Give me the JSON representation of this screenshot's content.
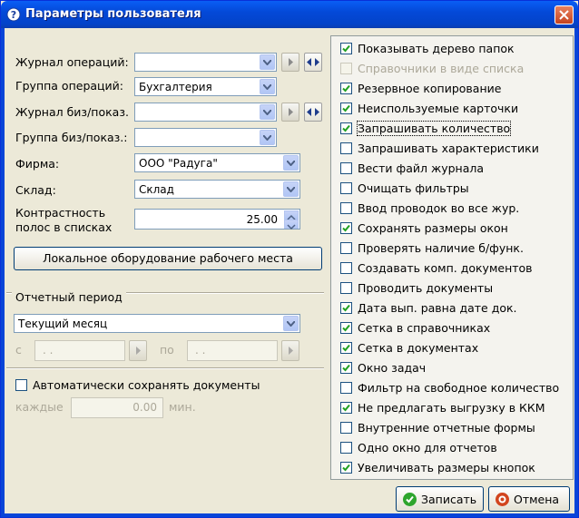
{
  "window": {
    "title": "Параметры пользователя"
  },
  "form": {
    "journal_ops": {
      "label": "Журнал операций:",
      "value": ""
    },
    "group_ops": {
      "label": "Группа операций:",
      "value": "Бухгалтерия"
    },
    "journal_biz": {
      "label": "Журнал биз/показ.",
      "value": ""
    },
    "group_biz": {
      "label": "Группа биз/показ.:",
      "value": ""
    },
    "firm": {
      "label": "Фирма:",
      "value": "ООО \"Радуга\""
    },
    "warehouse": {
      "label": "Склад:",
      "value": "Склад"
    },
    "contrast": {
      "label_line1": "Контрастность",
      "label_line2": "полос в списках",
      "value": "25.00"
    },
    "local_equipment_button": "Локальное оборудование рабочего места"
  },
  "period": {
    "section_label": "Отчетный период",
    "value": "Текущий месяц",
    "from_label": "с",
    "from_value": " . .",
    "to_label": "по",
    "to_value": " . ."
  },
  "autosave": {
    "label": "Автоматически сохранять документы",
    "checked": false,
    "every_label": "каждые",
    "every_value": "0.00",
    "unit_label": "мин."
  },
  "options": [
    {
      "label": "Показывать дерево папок",
      "checked": true,
      "enabled": true
    },
    {
      "label": "Справочники в виде списка",
      "checked": false,
      "enabled": false
    },
    {
      "label": "Резервное копирование",
      "checked": true,
      "enabled": true
    },
    {
      "label": "Неиспользуемые карточки",
      "checked": true,
      "enabled": true
    },
    {
      "label": "Запрашивать количество",
      "checked": true,
      "enabled": true
    },
    {
      "label": "Запрашивать характеристики",
      "checked": false,
      "enabled": true
    },
    {
      "label": "Вести файл журнала",
      "checked": false,
      "enabled": true
    },
    {
      "label": "Очищать фильтры",
      "checked": false,
      "enabled": true
    },
    {
      "label": "Ввод проводок во все жур.",
      "checked": false,
      "enabled": true
    },
    {
      "label": "Сохранять размеры окон",
      "checked": true,
      "enabled": true
    },
    {
      "label": "Проверять наличие б/функ.",
      "checked": false,
      "enabled": true
    },
    {
      "label": "Создавать комп. документов",
      "checked": false,
      "enabled": true
    },
    {
      "label": "Проводить документы",
      "checked": false,
      "enabled": true
    },
    {
      "label": "Дата вып. равна дате док.",
      "checked": true,
      "enabled": true
    },
    {
      "label": "Сетка в справочниках",
      "checked": true,
      "enabled": true
    },
    {
      "label": "Сетка в документах",
      "checked": true,
      "enabled": true
    },
    {
      "label": "Окно задач",
      "checked": true,
      "enabled": true
    },
    {
      "label": "Фильтр на свободное количество",
      "checked": false,
      "enabled": true
    },
    {
      "label": "Не предлагать выгрузку в ККМ",
      "checked": true,
      "enabled": true
    },
    {
      "label": "Внутренние отчетные формы",
      "checked": false,
      "enabled": true
    },
    {
      "label": "Одно окно для отчетов",
      "checked": false,
      "enabled": true
    },
    {
      "label": "Увеличивать размеры кнопок",
      "checked": true,
      "enabled": true
    }
  ],
  "buttons": {
    "save": "Записать",
    "cancel": "Отмена"
  },
  "colors": {
    "titlebar": "#0449D8",
    "dialog_bg": "#ECE9D8",
    "checkmark": "#21A121",
    "save_icon": "#2DA52D",
    "cancel_icon": "#D2451E"
  }
}
